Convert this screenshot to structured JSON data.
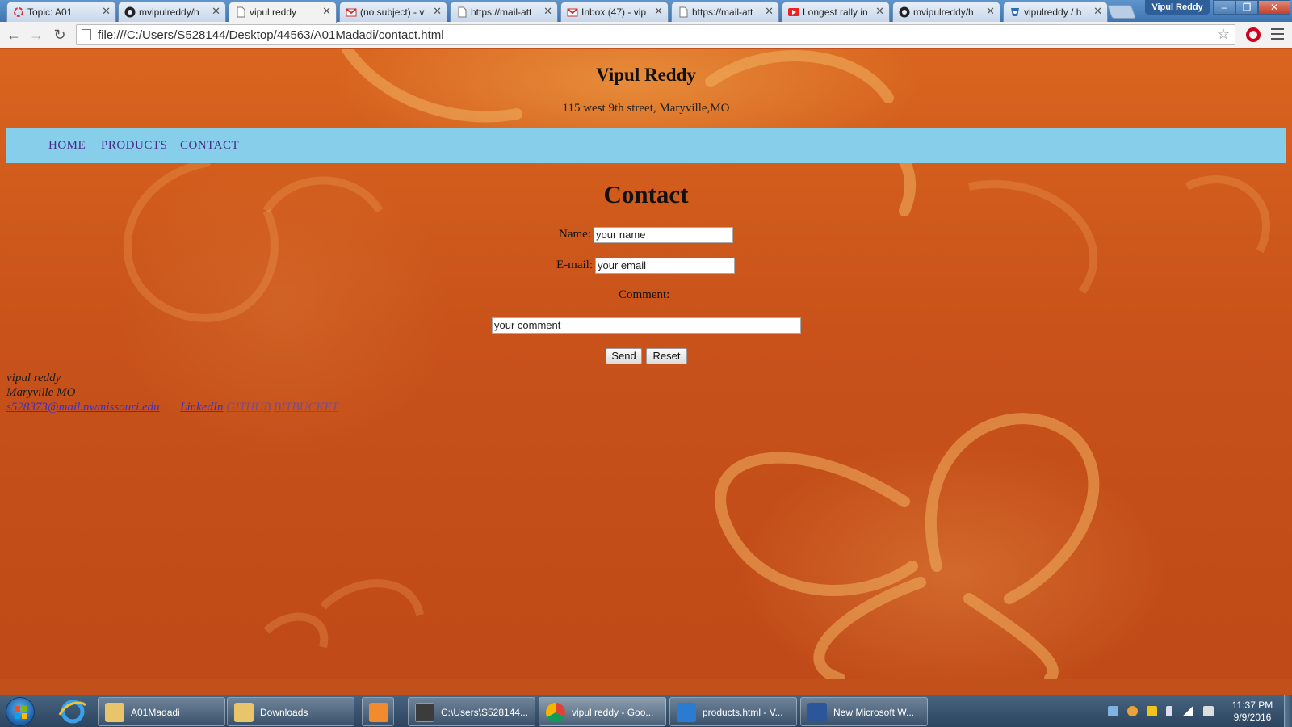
{
  "browser": {
    "tabs": [
      {
        "title": "Topic: A01",
        "icon": "loading-spinner-icon",
        "active": false
      },
      {
        "title": "mvipulreddy/h",
        "icon": "github-icon",
        "active": false
      },
      {
        "title": "vipul reddy",
        "icon": "page-icon",
        "active": true
      },
      {
        "title": "(no subject) - v",
        "icon": "gmail-icon",
        "active": false
      },
      {
        "title": "https://mail-att",
        "icon": "page-icon",
        "active": false
      },
      {
        "title": "Inbox (47) - vip",
        "icon": "gmail-icon",
        "active": false
      },
      {
        "title": "https://mail-att",
        "icon": "page-icon",
        "active": false
      },
      {
        "title": "Longest rally in",
        "icon": "youtube-icon",
        "active": false
      },
      {
        "title": "mvipulreddy/h",
        "icon": "github-icon",
        "active": false
      },
      {
        "title": "vipulreddy / h",
        "icon": "bitbucket-icon",
        "active": false
      }
    ],
    "profile_name": "Vipul Reddy",
    "url": "file:///C:/Users/S528144/Desktop/44563/A01Madadi/contact.html"
  },
  "page": {
    "site_title": "Vipul Reddy",
    "site_address": "115 west 9th street, Maryville,MO",
    "nav": {
      "home": "HOME",
      "products": "PRODUCTS",
      "contact": "CONTACT"
    },
    "heading": "Contact",
    "form": {
      "name_label": "Name:",
      "name_value": "your name",
      "email_label": "E-mail:",
      "email_value": "your email",
      "comment_label": "Comment:",
      "comment_value": "your comment",
      "send_label": "Send",
      "reset_label": "Reset"
    },
    "footer": {
      "name": "vipul reddy",
      "location": "Maryville MO",
      "email_link": "s528373@mail.nwmissouri.edu",
      "linkedin_link": "LinkedIn",
      "github_link": "GITHUB",
      "bitbucket_link": "BITBUCKET"
    }
  },
  "taskbar": {
    "items": [
      {
        "label": "A01Madadi",
        "icon": "folder-icon"
      },
      {
        "label": "Downloads",
        "icon": "folder-icon"
      },
      {
        "label": "",
        "icon": "media-player-icon"
      },
      {
        "label": "C:\\Users\\S528144...",
        "icon": "sublime-text-icon"
      },
      {
        "label": "vipul reddy - Goo...",
        "icon": "chrome-icon"
      },
      {
        "label": "products.html - V...",
        "icon": "visual-studio-code-icon"
      },
      {
        "label": "New Microsoft W...",
        "icon": "word-icon"
      }
    ],
    "clock_time": "11:37 PM",
    "clock_date": "9/9/2016"
  },
  "colors": {
    "navbar": "#87ceeb",
    "page_background": "#c8521a",
    "nav_link": "#4a2b8a"
  }
}
